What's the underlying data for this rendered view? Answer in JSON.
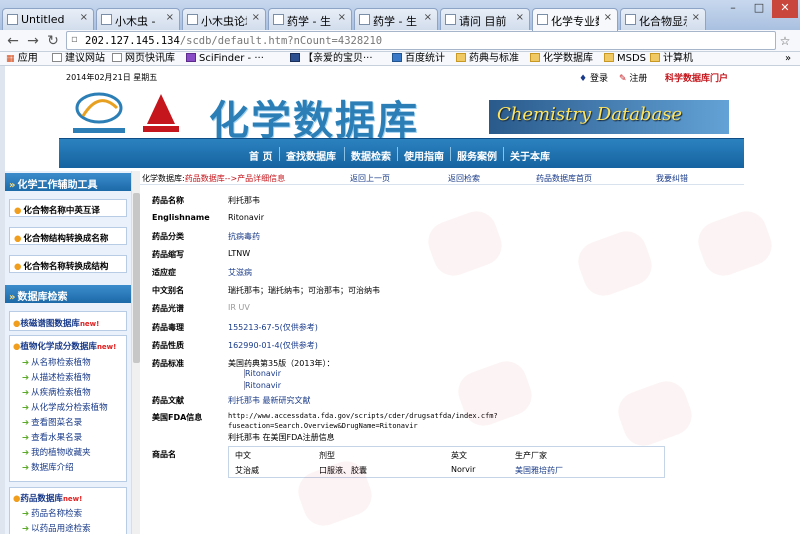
{
  "browser": {
    "tabs": [
      {
        "label": "Untitled"
      },
      {
        "label": "小木虫 - "
      },
      {
        "label": "小木虫论坛"
      },
      {
        "label": "药学 - 生"
      },
      {
        "label": "药学 - 生"
      },
      {
        "label": "请问 目前"
      },
      {
        "label": "化学专业数"
      },
      {
        "label": "化合物显示"
      }
    ],
    "close_glyph": "×",
    "url_host": "202.127.145.134",
    "url_path": "/scdb/default.htm?nCount=4328210",
    "bookmarks": [
      "应用",
      "建议网站",
      "网页快讯库",
      "SciFinder - ···",
      "【亲爱的宝贝···",
      "百度统计",
      "药典与标准",
      "化学数据库",
      "MSDS",
      "计算机"
    ],
    "more_glyph": "»"
  },
  "site": {
    "date": "2014年02月21日 星期五",
    "login": "登录",
    "register": "注册",
    "portal": "科学数据库门户",
    "title_cn": "化学数据库",
    "title_en": "Chemistry Database",
    "nav": [
      "首  页",
      "查找数据库",
      "数据检索",
      "使用指南",
      "服务案例",
      "关于本库"
    ]
  },
  "sidebar": {
    "section1_title": "化学工作辅助工具",
    "tools": [
      "化合物名称中英互译",
      "化合物结构转换成名称",
      "化合物名称转换成结构"
    ],
    "section2_title": "数据库检索",
    "nmr": {
      "label": "核磁谱图数据库",
      "badge": "new!"
    },
    "plant": {
      "label": "植物化学成分数据库",
      "badge": "new!"
    },
    "plant_items": [
      "从名称检索植物",
      "从描述检索植物",
      "从疾病检索植物",
      "从化学成分检索植物",
      "查看图菜名录",
      "查看水果名录",
      "我的植物收藏夹",
      "数据库介绍"
    ],
    "drug": {
      "label": "药品数据库",
      "badge": "new!"
    },
    "drug_items": [
      "药品名称检索",
      "以药品用途检索"
    ]
  },
  "breadcrumb": {
    "prefix": "化学数据库:",
    "path": "药品数据库-->产品详细信息",
    "back": "返回上一页",
    "return_search": "返回检索",
    "home": "药品数据库首页",
    "report": "我要纠错"
  },
  "drug": {
    "fields": [
      {
        "label": "药品名称",
        "value": "利托那韦"
      },
      {
        "label": "Englishname",
        "value": "Ritonavir"
      },
      {
        "label": "药品分类",
        "value": "抗病毒药"
      },
      {
        "label": "药品缩写",
        "value": "LTNW"
      },
      {
        "label": "适应症",
        "value": "艾滋病"
      },
      {
        "label": "中文别名",
        "value": "瑞托那韦；瑞托纳韦；可治那韦；可治纳韦"
      },
      {
        "label": "药品光谱",
        "value": "IR    UV"
      },
      {
        "label": "药品毒理",
        "value": "155213-67-5(仅供参考)"
      },
      {
        "label": "药品性质",
        "value": "162990-01-4(仅供参考)"
      },
      {
        "label": "药品标准",
        "value": "美国药典第35版（2013年）：",
        "links": [
          "Ritonavir",
          "Ritonavir"
        ]
      },
      {
        "label": "药品文献",
        "value": "利托那韦   最新研究文献"
      },
      {
        "label": "美国FDA信息",
        "value": "http://www.accessdata.fda.gov/scripts/cder/drugsatfda/index.cfm?",
        "value2": "fuseaction=Search.Overview&DrugName=Ritonavir",
        "value3": "利托那韦  在美国FDA注册信息"
      },
      {
        "label": "商品名"
      }
    ],
    "trade_table": {
      "headers": [
        "中文",
        "剂型",
        "英文",
        "生产厂家"
      ],
      "rows": [
        [
          "艾治威",
          "口服液、胶囊",
          "Norvir",
          "美国雅培药厂"
        ]
      ]
    }
  }
}
